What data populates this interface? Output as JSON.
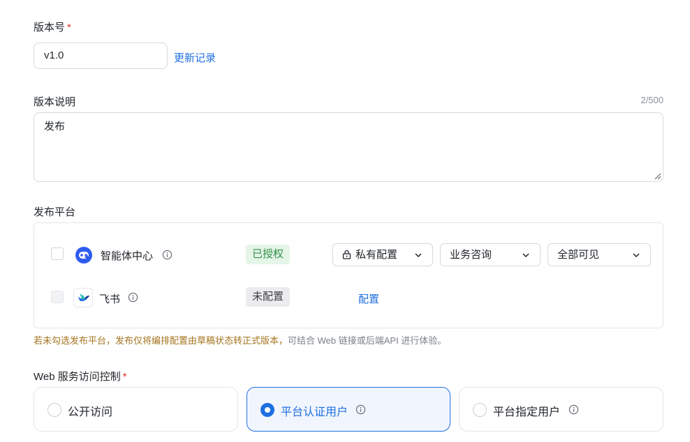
{
  "version": {
    "label": "版本号",
    "required_mark": "*",
    "value": "v1.0",
    "history_link": "更新记录"
  },
  "description": {
    "label": "版本说明",
    "counter": "2/500",
    "value": "发布"
  },
  "platforms": {
    "label": "发布平台",
    "items": [
      {
        "name": "智能体中心",
        "icon": "robot-icon",
        "status": "已授权",
        "visibility_select": "私有配置",
        "category_select": "业务咨询",
        "scope_select": "全部可见"
      },
      {
        "name": "飞书",
        "icon": "feishu-icon",
        "status": "未配置",
        "configure_link": "配置"
      }
    ],
    "warning": "若未勾选发布平台，发布仅将编排配置由草稿状态转正式版本，",
    "warning_tail": "可结合 Web 链接或后端API 进行体验。"
  },
  "web_access": {
    "label": "Web 服务访问控制",
    "required_mark": "*",
    "options": [
      {
        "label": "公开访问",
        "selected": false
      },
      {
        "label": "平台认证用户",
        "selected": true
      },
      {
        "label": "平台指定用户",
        "selected": false
      }
    ]
  },
  "colors": {
    "accent": "#1f6fe0",
    "required": "#e0342b",
    "warning": "#a4741f",
    "authorized_bg": "#e5f5e8",
    "authorized_text": "#2f8f46"
  }
}
